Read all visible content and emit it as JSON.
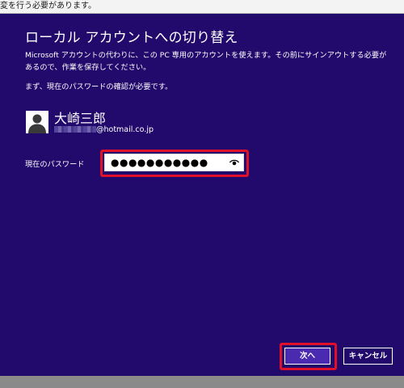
{
  "window": {
    "top_text": "変を行う必要があります。"
  },
  "dialog": {
    "title": "ローカル アカウントへの切り替え",
    "description": "Microsoft アカウントの代わりに、この PC 専用のアカウントを使えます。その前にサインアウトする必要があるので、作業を保存してください。",
    "instruction": "まず、現在のパスワードの確認が必要です。"
  },
  "user": {
    "name": "大崎三郎",
    "email_domain": "@hotmail.co.jp",
    "avatar_icon": "user-silhouette-icon"
  },
  "password": {
    "label": "現在のパスワード",
    "masked_value": "●●●●●●●●●●●",
    "reveal_icon": "eye-icon"
  },
  "buttons": {
    "next_label": "次へ",
    "cancel_label": "キャンセル"
  },
  "colors": {
    "panel_background": "#22096c",
    "highlight": "#e0102a",
    "primary_button": "#4a2ab0"
  }
}
